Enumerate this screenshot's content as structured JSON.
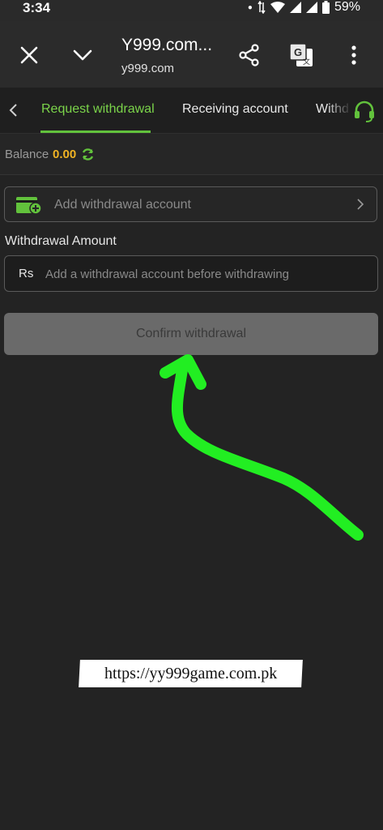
{
  "status_bar": {
    "time": "3:34",
    "battery": "59%"
  },
  "browser": {
    "site_title": "Y999.com...",
    "site_url": "y999.com",
    "icons": [
      "close-icon",
      "chevron-down-icon",
      "share-icon",
      "translate-icon",
      "more-vertical-icon"
    ]
  },
  "tabs": {
    "items": [
      {
        "label": "Request withdrawal",
        "active": true
      },
      {
        "label": "Receiving account",
        "active": false
      },
      {
        "label": "Withd",
        "active": false
      }
    ]
  },
  "balance": {
    "label": "Balance",
    "value": "0.00"
  },
  "add_account": {
    "label": "Add withdrawal account"
  },
  "amount": {
    "heading": "Withdrawal Amount",
    "currency": "Rs",
    "placeholder": "Add a withdrawal account before withdrawing"
  },
  "confirm": {
    "label": "Confirm withdrawal"
  },
  "caption": {
    "text": "https://yy999game.com.pk"
  },
  "colors": {
    "accent_green": "#62c23c",
    "balance_gold": "#f0b323",
    "arrow_green": "#22ee22",
    "background": "#232323"
  }
}
